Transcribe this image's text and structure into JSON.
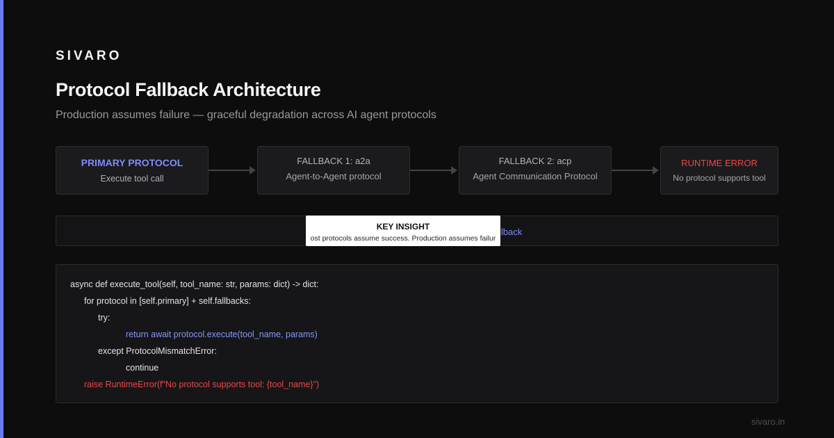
{
  "brand": "SIVARO",
  "title": "Protocol Fallback Architecture",
  "subtitle": "Production assumes failure — graceful degradation across AI agent protocols",
  "flow": {
    "primary": {
      "head": "PRIMARY PROTOCOL",
      "desc": "Execute tool call"
    },
    "fallback1": {
      "head": "FALLBACK 1: a2a",
      "desc": "Agent-to-Agent protocol"
    },
    "fallback2": {
      "head": "FALLBACK 2: acp",
      "desc": "Agent Communication Protocol"
    },
    "error": {
      "head": "RUNTIME ERROR",
      "desc": "No protocol supports tool"
    }
  },
  "insight": {
    "visible_tail": "llback",
    "popup_heading": "KEY INSIGHT",
    "popup_text": "ost protocols assume success. Production assumes failur"
  },
  "code": {
    "line1": "async def execute_tool(self, tool_name: str, params: dict) -> dict:",
    "line2": "for protocol in [self.primary] + self.fallbacks:",
    "line3": "try:",
    "line4": "return await protocol.execute(tool_name, params)",
    "line5": "except ProtocolMismatchError:",
    "line6": "continue",
    "line7": "raise RuntimeError(f\"No protocol supports tool: {tool_name}\")"
  },
  "footer": "sivaro.in",
  "colors": {
    "accent": "#6b7cf0",
    "error": "#ec4747",
    "background": "#0d0d0d"
  }
}
